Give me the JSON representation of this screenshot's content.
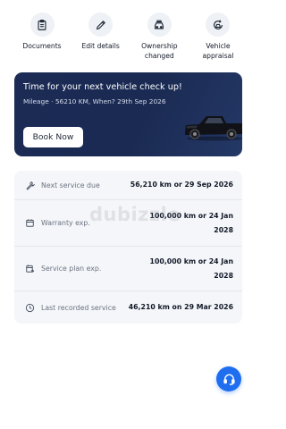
{
  "quick_actions": [
    {
      "label": "Documents",
      "icon": "clipboard-icon"
    },
    {
      "label": "Edit details",
      "icon": "pencil-icon"
    },
    {
      "label": "Ownership changed",
      "icon": "car-owner-icon"
    },
    {
      "label": "Vehicle appraisal",
      "icon": "appraisal-icon"
    }
  ],
  "banner": {
    "title": "Time for your next vehicle check up!",
    "subtitle": "Mileage · 56210 KM, When? 29th Sep 2026",
    "button_label": "Book Now"
  },
  "service_info": [
    {
      "label": "Next service due",
      "value": "56,210 km or 29 Sep 2026",
      "icon": "wrench-icon"
    },
    {
      "label": "Warranty exp.",
      "value": "100,000 km or 24 Jan 2028",
      "icon": "calendar-icon"
    },
    {
      "label": "Service plan exp.",
      "value": "100,000 km or 24 Jan 2028",
      "icon": "service-plan-icon"
    },
    {
      "label": "Last recorded service",
      "value": "46,210 km on 29 Mar 2026",
      "icon": "clock-icon"
    }
  ],
  "watermark": "dubizzle",
  "colors": {
    "accent": "#1f6ef0",
    "banner_bg": "#1c2b55",
    "list_bg": "#f4f6f9"
  }
}
